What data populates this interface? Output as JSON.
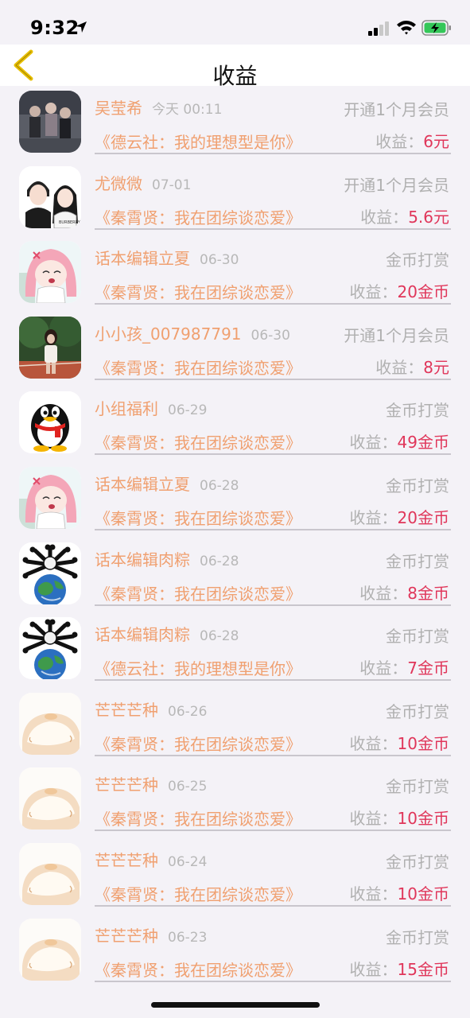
{
  "status_bar": {
    "time": "9:32"
  },
  "nav": {
    "title": "收益"
  },
  "earn_label": "收益：",
  "records": [
    {
      "avatar": "photo-avatar",
      "name": "吴莹希",
      "date": "今天 00:11",
      "type": "开通1个月会员",
      "work": "《德云社：我的理想型是你》",
      "earning": "6元"
    },
    {
      "avatar": "couple-cartoon-avatar",
      "name": "尤微微",
      "date": "07-01",
      "type": "开通1个月会员",
      "work": "《秦霄贤：我在团综谈恋爱》",
      "earning": "5.6元"
    },
    {
      "avatar": "anime-girl-avatar",
      "name": "话本编辑立夏",
      "date": "06-30",
      "type": "金币打赏",
      "work": "《秦霄贤：我在团综谈恋爱》",
      "earning": "20金币"
    },
    {
      "avatar": "outdoor-photo-avatar",
      "name": "小小孩_007987791",
      "date": "06-30",
      "type": "开通1个月会员",
      "work": "《秦霄贤：我在团综谈恋爱》",
      "earning": "8元"
    },
    {
      "avatar": "penguin-avatar",
      "name": "小组福利",
      "date": "06-29",
      "type": "金币打赏",
      "work": "《秦霄贤：我在团综谈恋爱》",
      "earning": "49金币"
    },
    {
      "avatar": "anime-girl-avatar",
      "name": "话本编辑立夏",
      "date": "06-28",
      "type": "金币打赏",
      "work": "《秦霄贤：我在团综谈恋爱》",
      "earning": "20金币"
    },
    {
      "avatar": "earth-bones-avatar",
      "name": "话本编辑肉粽",
      "date": "06-28",
      "type": "金币打赏",
      "work": "《秦霄贤：我在团综谈恋爱》",
      "earning": "8金币"
    },
    {
      "avatar": "earth-bones-avatar",
      "name": "话本编辑肉粽",
      "date": "06-28",
      "type": "金币打赏",
      "work": "《德云社：我的理想型是你》",
      "earning": "7金币"
    },
    {
      "avatar": "bun-avatar",
      "name": "芒芒芒种",
      "date": "06-26",
      "type": "金币打赏",
      "work": "《秦霄贤：我在团综谈恋爱》",
      "earning": "10金币"
    },
    {
      "avatar": "bun-avatar",
      "name": "芒芒芒种",
      "date": "06-25",
      "type": "金币打赏",
      "work": "《秦霄贤：我在团综谈恋爱》",
      "earning": "10金币"
    },
    {
      "avatar": "bun-avatar",
      "name": "芒芒芒种",
      "date": "06-24",
      "type": "金币打赏",
      "work": "《秦霄贤：我在团综谈恋爱》",
      "earning": "10金币"
    },
    {
      "avatar": "bun-avatar",
      "name": "芒芒芒种",
      "date": "06-23",
      "type": "金币打赏",
      "work": "《秦霄贤：我在团综谈恋爱》",
      "earning": "15金币"
    }
  ]
}
